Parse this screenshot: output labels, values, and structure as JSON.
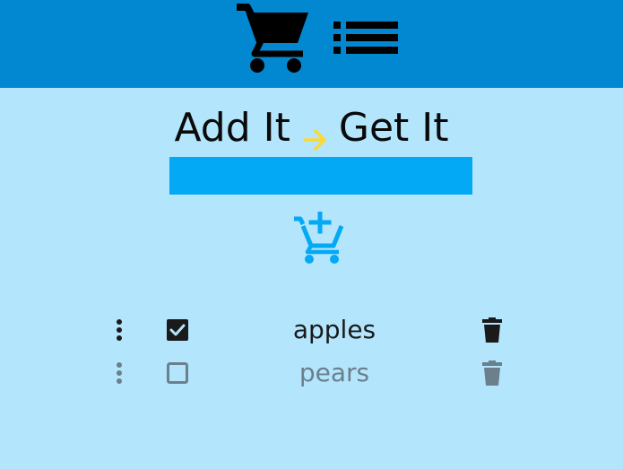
{
  "header": {
    "cart_icon": "shopping-cart-icon",
    "list_icon": "list-icon",
    "bar_color": "#0288d1"
  },
  "title": {
    "left": "Add It",
    "right": "Get It",
    "arrow_icon": "arrow-right-icon",
    "arrow_color": "#fdd835"
  },
  "input": {
    "value": "",
    "placeholder": "",
    "color": "#03a9f4"
  },
  "add_button": {
    "icon": "add-to-cart-icon",
    "color": "#03a9f4"
  },
  "items": [
    {
      "label": "apples",
      "checked": true,
      "drag_icon": "drag-handle-icon",
      "delete_icon": "trash-icon"
    },
    {
      "label": "pears",
      "checked": false,
      "drag_icon": "drag-handle-icon",
      "delete_icon": "trash-icon"
    }
  ],
  "background_color": "#b3e5fc"
}
